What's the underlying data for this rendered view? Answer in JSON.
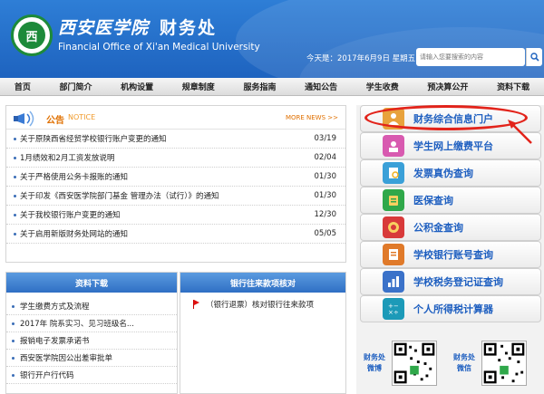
{
  "header": {
    "logo_char": "西",
    "university_name": "西安医学院",
    "office_name": "财务处",
    "office_name_en": "Financial Office of Xi'an Medical University",
    "date_text": "今天是：2017年6月9日 星期五",
    "search": {
      "placeholder": "请输入您要搜索的内容"
    }
  },
  "nav": {
    "items": [
      "首页",
      "部门简介",
      "机构设置",
      "规章制度",
      "服务指南",
      "通知公告",
      "学生收费",
      "预决算公开",
      "资料下载"
    ]
  },
  "notice": {
    "title": "公告",
    "title_en": "NOTICE",
    "more_label": "MORE NEWS >>",
    "rows": [
      {
        "text": "关于原陕西省经贸学校银行账户变更的通知",
        "date": "03/19"
      },
      {
        "text": "1月绩效和2月工资发放说明",
        "date": "02/04"
      },
      {
        "text": "关于严格使用公务卡报账的通知",
        "date": "01/30"
      },
      {
        "text": "关于印发《西安医学院部门基金 管理办法（试行）》的通知",
        "date": "01/30"
      },
      {
        "text": "关于我校银行账户变更的通知",
        "date": "12/30"
      },
      {
        "text": "关于启用新版财务处网站的通知",
        "date": "05/05"
      }
    ]
  },
  "downloads": {
    "title": "资料下载",
    "items": [
      "学生缴费方式及流程",
      "2017年 院系实习、见习班级名...",
      "报销电子发票承诺书",
      "西安医学院因公出差审批单",
      "银行开户行代码"
    ]
  },
  "bank": {
    "title": "银行往来款项核对",
    "items": [
      "（银行退票）核对银行往来款项"
    ]
  },
  "services": [
    {
      "label": "财务综合信息门户",
      "icon": "user-portal-icon",
      "color": "#e8a23c"
    },
    {
      "label": "学生网上缴费平台",
      "icon": "student-payment-icon",
      "color": "#d85ab0"
    },
    {
      "label": "发票真伪查询",
      "icon": "invoice-check-icon",
      "color": "#3aa0d8"
    },
    {
      "label": "医保查询",
      "icon": "medical-insurance-icon",
      "color": "#2fa84a"
    },
    {
      "label": "公积金查询",
      "icon": "housing-fund-icon",
      "color": "#d83a3a"
    },
    {
      "label": "学校银行账号查询",
      "icon": "bank-account-icon",
      "color": "#e07a2a"
    },
    {
      "label": "学校税务登记证查询",
      "icon": "tax-certificate-icon",
      "color": "#3b72c9"
    },
    {
      "label": "个人所得税计算器",
      "icon": "calculator-icon",
      "color": "#1c9ab8"
    }
  ],
  "social": {
    "weibo_label": "财务处微博",
    "wechat_label": "财务处微信"
  }
}
